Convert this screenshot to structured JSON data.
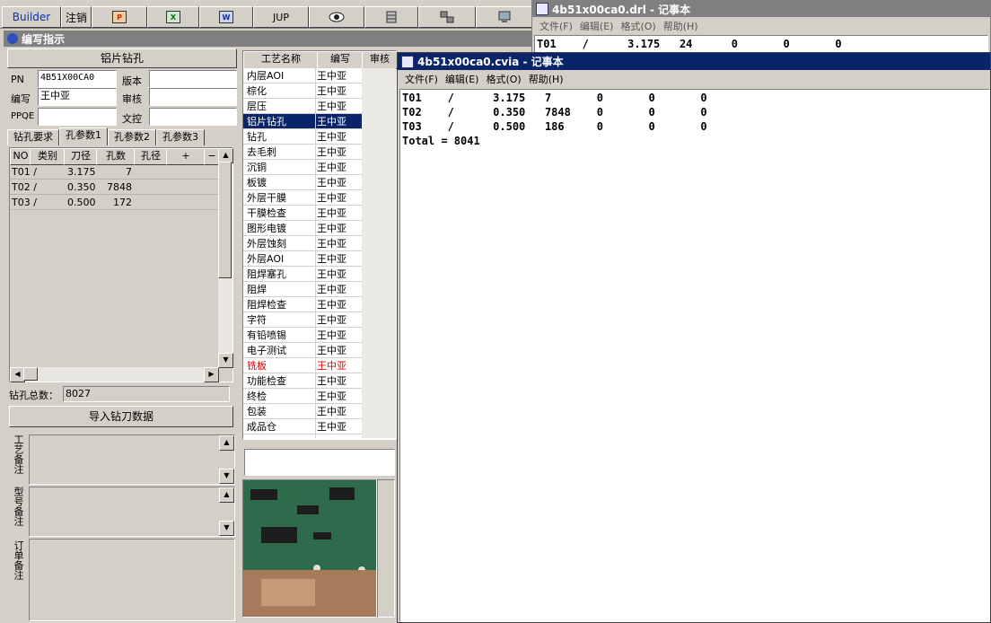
{
  "toolbar": {
    "builder": "Builder",
    "logout": "注销",
    "jup": "JUP",
    "icons": [
      "ppt-icon",
      "excel-icon",
      "word-icon",
      "jup-icon",
      "eye-icon",
      "database-icon",
      "network-icon",
      "computer-icon"
    ],
    "excel_glyph": "X",
    "word_glyph": "W",
    "ppt_glyph": "P"
  },
  "main_window": {
    "title": "编写指示"
  },
  "left": {
    "section_title": "铝片钻孔",
    "pn_label": "PN",
    "pn_value": "4B51X00CA0",
    "version_label": "版本",
    "version_value": "",
    "writer_label": "编写",
    "writer_value": "王中亚",
    "review_label": "审核",
    "review_value": "",
    "ppqe_label": "PPQE",
    "ppqe_value": "",
    "doc_label": "文控",
    "doc_value": "",
    "tabs": [
      "钻孔要求",
      "孔参数1",
      "孔参数2",
      "孔参数3"
    ],
    "active_tab": "孔参数1",
    "grid_headers": [
      "NO",
      "类别",
      "刀径",
      "孔数",
      "孔径",
      "+",
      "−"
    ],
    "grid_rows": [
      {
        "no": "T01 /",
        "dia": "3.175",
        "count": "7"
      },
      {
        "no": "T02 /",
        "dia": "0.350",
        "count": "7848"
      },
      {
        "no": "T03 /",
        "dia": "0.500",
        "count": "172"
      }
    ],
    "total_label": "钻孔总数：",
    "total_value": "8027",
    "import_button": "导入钻刀数据",
    "note1": "工艺备注",
    "note2": "型号备注",
    "note3": "订单备注"
  },
  "process": {
    "headers": [
      "工艺名称",
      "编写",
      "审核"
    ],
    "rows": [
      {
        "name": "内层AOI",
        "writer": "王中亚"
      },
      {
        "name": "棕化",
        "writer": "王中亚"
      },
      {
        "name": "层压",
        "writer": "王中亚"
      },
      {
        "name": "铝片钻孔",
        "writer": "王中亚"
      },
      {
        "name": "钻孔",
        "writer": "王中亚"
      },
      {
        "name": "去毛刺",
        "writer": "王中亚"
      },
      {
        "name": "沉铜",
        "writer": "王中亚"
      },
      {
        "name": "板镀",
        "writer": "王中亚"
      },
      {
        "name": "外层干膜",
        "writer": "王中亚"
      },
      {
        "name": "干膜检查",
        "writer": "王中亚"
      },
      {
        "name": "图形电镀",
        "writer": "王中亚"
      },
      {
        "name": "外层蚀刻",
        "writer": "王中亚"
      },
      {
        "name": "外层AOI",
        "writer": "王中亚"
      },
      {
        "name": "阻焊塞孔",
        "writer": "王中亚"
      },
      {
        "name": "阻焊",
        "writer": "王中亚"
      },
      {
        "name": "阻焊检查",
        "writer": "王中亚"
      },
      {
        "name": "字符",
        "writer": "王中亚"
      },
      {
        "name": "有铅喷锡",
        "writer": "王中亚"
      },
      {
        "name": "电子测试",
        "writer": "王中亚"
      },
      {
        "name": "铣板",
        "writer": "王中亚"
      },
      {
        "name": "功能检查",
        "writer": "王中亚"
      },
      {
        "name": "终检",
        "writer": "王中亚"
      },
      {
        "name": "包装",
        "writer": "王中亚"
      },
      {
        "name": "成品仓",
        "writer": "王中亚"
      }
    ],
    "selected_index": 3,
    "highlight_index": 19,
    "highlight_color": "#e00000"
  },
  "notepad_back": {
    "title": "4b51x00ca0.drl - 记事本",
    "menu": [
      "文件(F)",
      "编辑(E)",
      "格式(O)",
      "帮助(H)"
    ],
    "line": "T01    /      3.175   24      0       0       0"
  },
  "notepad_front": {
    "title": "4b51x00ca0.cvia - 记事本",
    "menu": [
      "文件(F)",
      "编辑(E)",
      "格式(O)",
      "帮助(H)"
    ],
    "content": "T01    /      3.175   7       0       0       0\nT02    /      0.350   7848    0       0       0\nT03    /      0.500   186     0       0       0\nTotal = 8041"
  },
  "colors": {
    "title_active": "#0a246a",
    "title_inactive": "#808080",
    "selection": "#0a246a"
  }
}
